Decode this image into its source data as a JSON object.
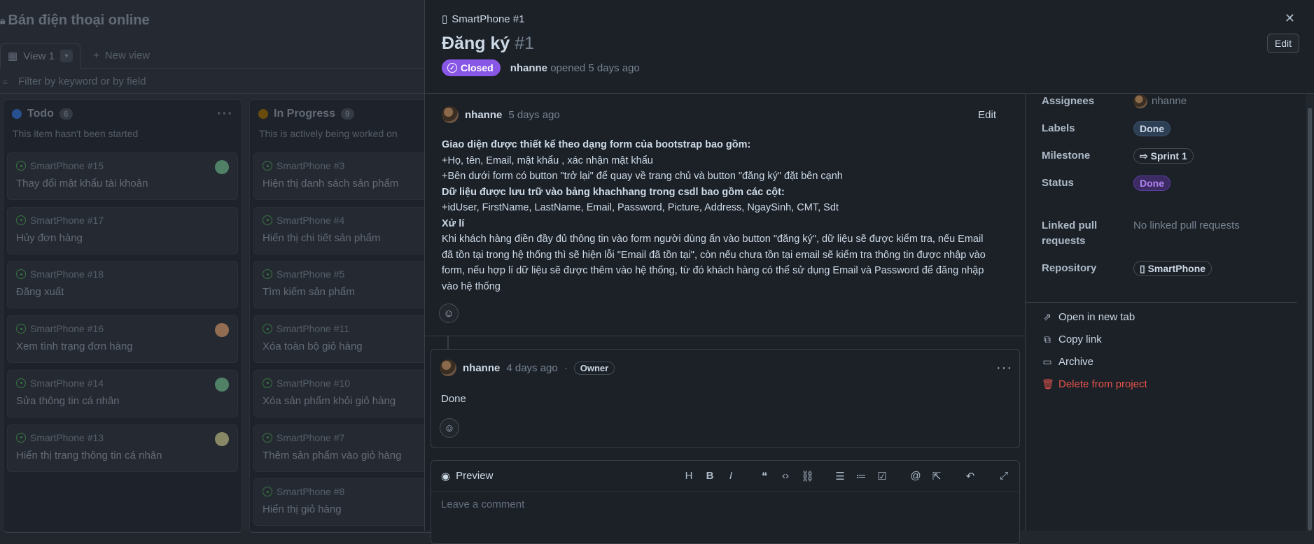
{
  "board": {
    "title": "Bán điện thoại online",
    "view_tab": "View 1",
    "new_view": "New view",
    "filter_placeholder": "Filter by keyword or by field",
    "columns": [
      {
        "name": "Todo",
        "count": "6",
        "description": "This item hasn't been started",
        "color": "#316dca",
        "cards": [
          {
            "ref": "SmartPhone #15",
            "title": "Thay đổi mật khẩu tài khoản"
          },
          {
            "ref": "SmartPhone #17",
            "title": "Hủy đơn hàng"
          },
          {
            "ref": "SmartPhone #18",
            "title": "Đăng xuất"
          },
          {
            "ref": "SmartPhone #16",
            "title": "Xem tình trạng đơn hàng"
          },
          {
            "ref": "SmartPhone #14",
            "title": "Sửa thông tin cá nhân"
          },
          {
            "ref": "SmartPhone #13",
            "title": "Hiển thị trang thông tin cá nhân"
          }
        ]
      },
      {
        "name": "In Progress",
        "count": "9",
        "description": "This is actively being worked on",
        "color": "#966600",
        "cards": [
          {
            "ref": "SmartPhone #3",
            "title": "Hiện thị danh sách sản phẩm"
          },
          {
            "ref": "SmartPhone #4",
            "title": "Hiển thị chi tiết sản phẩm"
          },
          {
            "ref": "SmartPhone #5",
            "title": "Tìm kiếm sản phẩm"
          },
          {
            "ref": "SmartPhone #11",
            "title": "Xóa toàn bộ giỏ hàng"
          },
          {
            "ref": "SmartPhone #10",
            "title": "Xóa sản phẩm khỏi giỏ hàng"
          },
          {
            "ref": "SmartPhone #7",
            "title": "Thêm sản phẩm vào giỏ hàng"
          },
          {
            "ref": "SmartPhone #8",
            "title": "Hiển thị giỏ hàng"
          }
        ]
      }
    ]
  },
  "issue": {
    "repo_ref": "SmartPhone #1",
    "title": "Đăng ký",
    "number": "#1",
    "state": "Closed",
    "author": "nhanne",
    "opened_text": "opened 5 days ago",
    "edit_label": "Edit",
    "close_icon": "close-icon",
    "comment": {
      "author": "nhanne",
      "time": "5 days ago",
      "edit_label": "Edit",
      "lines": [
        {
          "text": "Giao diện được thiết kế theo dạng form của bootstrap bao gồm:",
          "bold": true
        },
        {
          "text": "+Họ, tên, Email, mật khẩu , xác nhận mật khẩu",
          "bold": false
        },
        {
          "text": "+Bên dưới form có button \"trở lại\" để quay về trang chủ và button \"đăng ký\" đặt bên cạnh",
          "bold": false
        },
        {
          "text": "Dữ liệu được lưu trữ vào bảng khachhang trong csdl bao gồm các cột:",
          "bold": true
        },
        {
          "text": "+idUser, FirstName, LastName, Email, Password, Picture, Address, NgaySinh, CMT, Sdt",
          "bold": false
        },
        {
          "text": "Xử lí",
          "bold": true
        },
        {
          "text": "Khi khách hàng điền đầy đủ thông tin vào form người dùng ấn vào button \"đăng ký\", dữ liệu sẽ được kiểm tra, nếu Email",
          "bold": false
        },
        {
          "text": "đã tồn tại trong hệ thống thì sẽ hiện lỗi \"Email đã tồn tại\", còn nếu chưa tồn tại email sẽ kiểm tra thông tin được nhập vào",
          "bold": false
        },
        {
          "text": "form, nếu hợp lí dữ liệu sẽ được thêm vào hệ thống, từ đó khách hàng có thể sử dụng Email và Password để đăng nhập",
          "bold": false
        },
        {
          "text": "vào hệ thống",
          "bold": false
        }
      ]
    },
    "reply": {
      "author": "nhanne",
      "time": "4 days ago",
      "separator": "·",
      "role": "Owner",
      "body": "Done"
    },
    "editor": {
      "preview_label": "Preview",
      "placeholder": "Leave a comment",
      "tools": [
        "H",
        "B",
        "I"
      ]
    }
  },
  "sidebar": {
    "assignees_label": "Assignees",
    "assignee": "nhanne",
    "labels_label": "Labels",
    "label": "Done",
    "milestone_label": "Milestone",
    "milestone": "Sprint 1",
    "status_label": "Status",
    "status": "Done",
    "linked_label": "Linked pull requests",
    "linked_value": "No linked pull requests",
    "repository_label": "Repository",
    "repository": "SmartPhone",
    "actions": {
      "open_new_tab": "Open in new tab",
      "copy_link": "Copy link",
      "archive": "Archive",
      "delete": "Delete from project"
    }
  },
  "colors": {
    "closed_badge": "#8957e5",
    "danger": "#e5534b",
    "open_icon": "#47a352"
  }
}
